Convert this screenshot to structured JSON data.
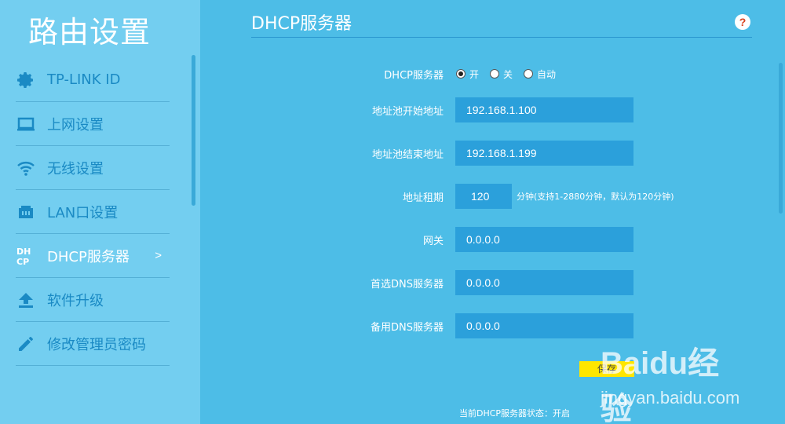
{
  "sidebar": {
    "title": "路由设置",
    "items": [
      {
        "label": "TP-LINK ID",
        "icon": "gear-icon"
      },
      {
        "label": "上网设置",
        "icon": "laptop-icon"
      },
      {
        "label": "无线设置",
        "icon": "wifi-icon"
      },
      {
        "label": "LAN口设置",
        "icon": "lan-port-icon"
      },
      {
        "label": "DHCP服务器",
        "icon": "dhcp-icon",
        "active": true,
        "arrow": ">"
      },
      {
        "label": "软件升级",
        "icon": "upload-icon"
      },
      {
        "label": "修改管理员密码",
        "icon": "pencil-icon"
      }
    ]
  },
  "main": {
    "title": "DHCP服务器",
    "help_icon": "?",
    "dhcp_label": "DHCP服务器",
    "dhcp_options": [
      {
        "label": "开",
        "checked": true
      },
      {
        "label": "关",
        "checked": false
      },
      {
        "label": "自动",
        "checked": false
      }
    ],
    "fields": {
      "pool_start": {
        "label": "地址池开始地址",
        "value": "192.168.1.100"
      },
      "pool_end": {
        "label": "地址池结束地址",
        "value": "192.168.1.199"
      },
      "lease": {
        "label": "地址租期",
        "value": "120",
        "hint": "分钟(支持1-2880分钟，默认为120分钟)"
      },
      "gateway": {
        "label": "网关",
        "value": "0.0.0.0"
      },
      "dns_primary": {
        "label": "首选DNS服务器",
        "value": "0.0.0.0"
      },
      "dns_secondary": {
        "label": "备用DNS服务器",
        "value": "0.0.0.0"
      }
    },
    "save_label": "保存",
    "status_text": "当前DHCP服务器状态：开启"
  },
  "watermark": {
    "logo": "Baidu经验",
    "url": "jingyan.baidu.com"
  },
  "colors": {
    "background": "#4dbde7",
    "sidebar": "#73cef0",
    "field": "#2ba0db",
    "save_button": "#ffe600",
    "nav_text": "#1a8ac4"
  }
}
